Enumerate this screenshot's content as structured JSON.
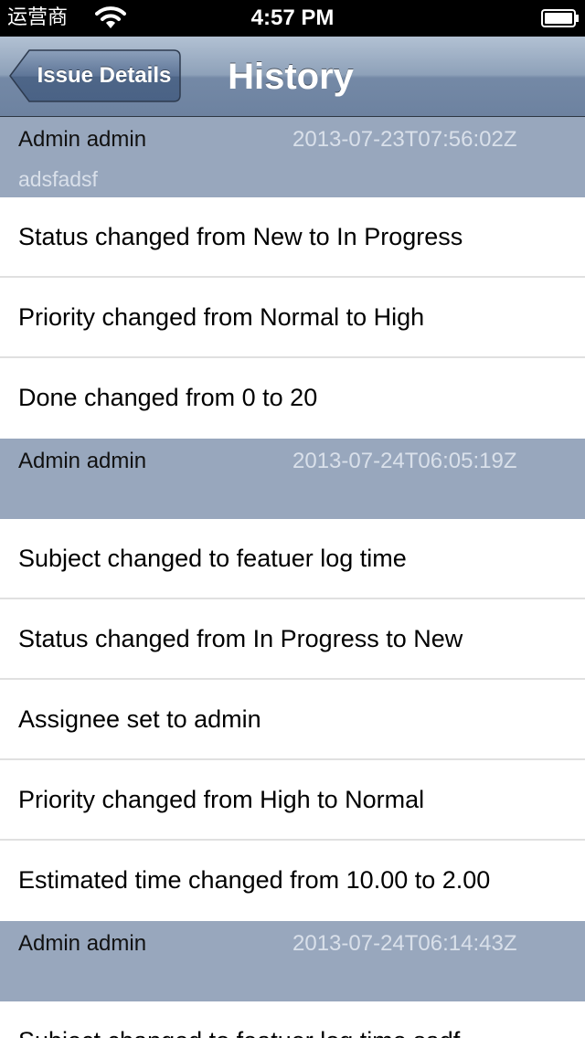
{
  "status_bar": {
    "carrier": "运营商",
    "time": "4:57 PM"
  },
  "nav": {
    "back_label": "Issue Details",
    "title": "History"
  },
  "journals": [
    {
      "author": "Admin admin",
      "timestamp": "2013-07-23T07:56:02Z",
      "notes": "adsfadsf",
      "details": [
        "Status changed from New to In Progress",
        "Priority changed from Normal to High",
        "Done changed from 0 to 20"
      ]
    },
    {
      "author": "Admin admin",
      "timestamp": "2013-07-24T06:05:19Z",
      "notes": "",
      "details": [
        "Subject changed to featuer log time",
        "Status changed from In Progress to New",
        "Assignee set to admin",
        "Priority changed from High to Normal",
        "Estimated time changed from 10.00 to 2.00"
      ]
    },
    {
      "author": "Admin admin",
      "timestamp": "2013-07-24T06:14:43Z",
      "notes": "",
      "details": [
        "Subject changed to featuer log time sadf"
      ]
    }
  ],
  "icons": {
    "wifi": "wifi-icon",
    "battery": "battery-icon",
    "back": "back-chevron-icon"
  },
  "colors": {
    "section_header_bg": "#98a7bd",
    "nav_bar": "#7d91ad",
    "timestamp_text": "#d9e0ea"
  }
}
